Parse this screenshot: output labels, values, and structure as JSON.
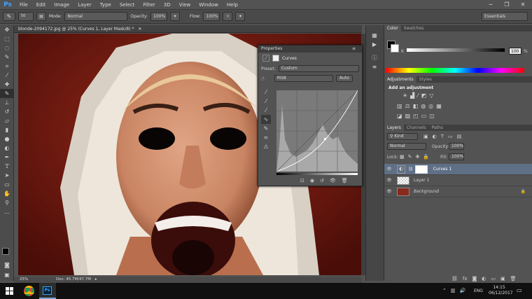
{
  "app": {
    "logo": "Ps"
  },
  "menu": [
    "File",
    "Edit",
    "Image",
    "Layer",
    "Type",
    "Select",
    "Filter",
    "3D",
    "View",
    "Window",
    "Help"
  ],
  "window_controls": [
    "─",
    "❐",
    "✕"
  ],
  "options": {
    "brush_size": "50",
    "mode_label": "Mode:",
    "mode_value": "Normal",
    "opacity_label": "Opacity:",
    "opacity_value": "100%",
    "flow_label": "Flow:",
    "flow_value": "100%",
    "workspace": "Essentials"
  },
  "document": {
    "tab_title": "blonde-2094172.jpg @ 25% (Curves 1, Layer Mask/8) *",
    "zoom": "25%",
    "doc_size": "Doc: 45.7M/47.7M"
  },
  "properties": {
    "title": "Properties",
    "subtitle": "Curves",
    "preset_label": "Preset:",
    "preset_value": "Custom",
    "channel": "RGB",
    "auto_label": "Auto"
  },
  "color_panel": {
    "tabs": [
      "Color",
      "Swatches"
    ],
    "k_label": "K",
    "k_value": "100",
    "k_unit": "%"
  },
  "adjustments": {
    "tabs": [
      "Adjustments",
      "Styles"
    ],
    "heading": "Add an adjustment"
  },
  "layers_panel": {
    "tabs": [
      "Layers",
      "Channels",
      "Paths"
    ],
    "kind_label": "Kind",
    "blend_mode": "Normal",
    "opacity_label": "Opacity:",
    "opacity_value": "100%",
    "lock_label": "Lock:",
    "fill_label": "Fill:",
    "fill_value": "100%",
    "layers": [
      {
        "name": "Curves 1",
        "selected": true
      },
      {
        "name": "Layer 1",
        "selected": false
      },
      {
        "name": "Background",
        "selected": false
      }
    ]
  },
  "taskbar": {
    "language": "ENG",
    "time": "14:15",
    "date": "06/12/2017"
  },
  "colors": {
    "accent": "#3fa2ff",
    "selection": "#5f6f86",
    "canvas_bg": "#7a1c12"
  }
}
